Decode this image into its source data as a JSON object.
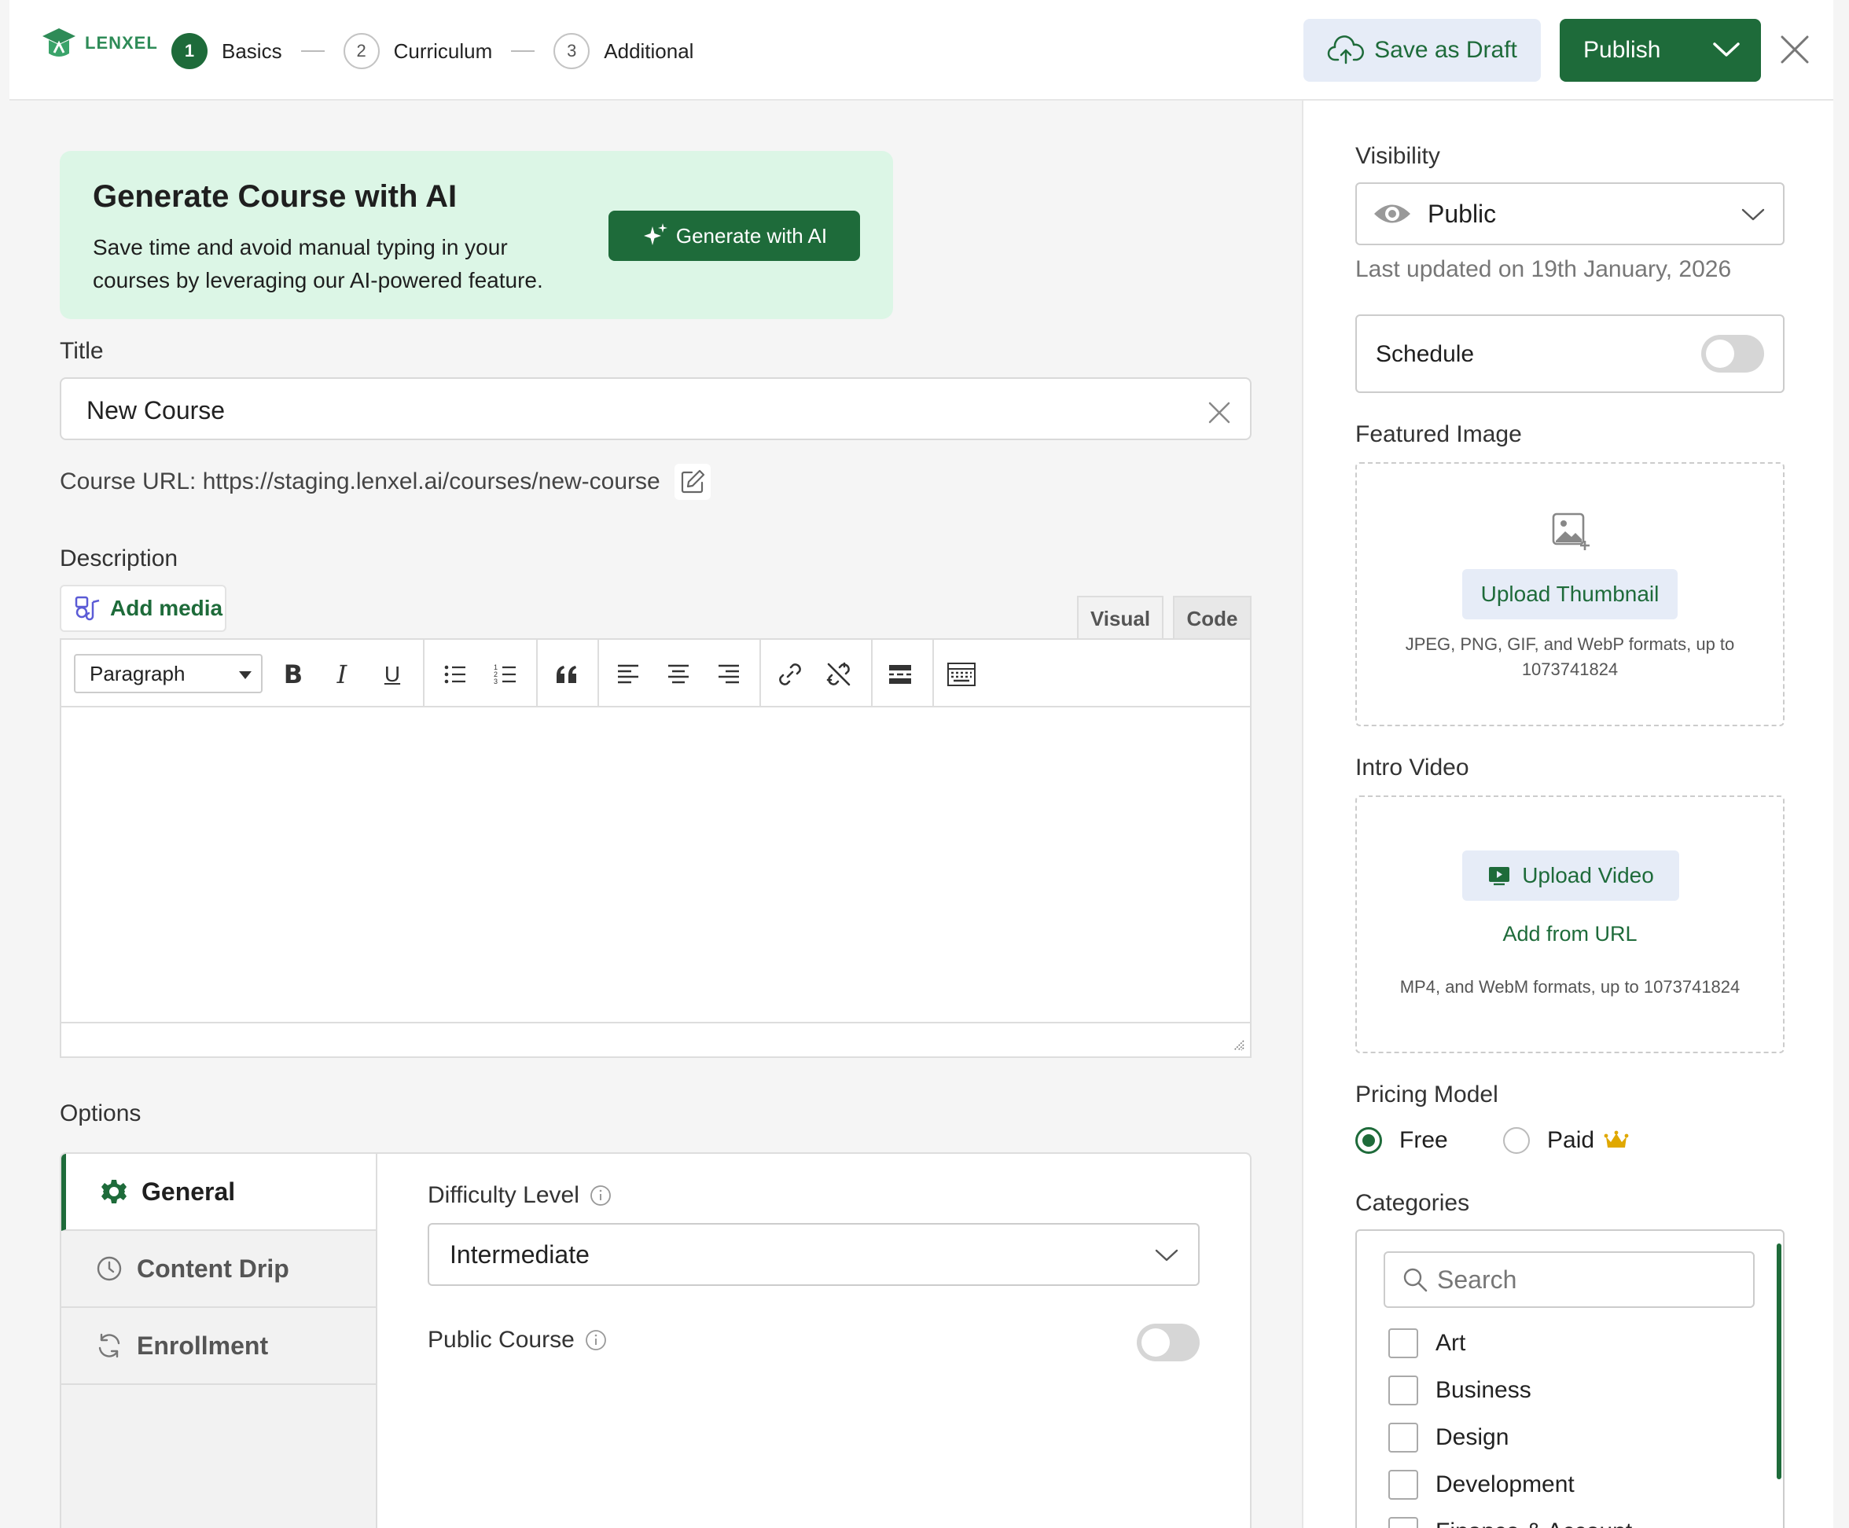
{
  "brand": {
    "name": "LENXEL",
    "accent": "#1e6b3a"
  },
  "steps": [
    {
      "num": "1",
      "label": "Basics"
    },
    {
      "num": "2",
      "label": "Curriculum"
    },
    {
      "num": "3",
      "label": "Additional"
    }
  ],
  "header": {
    "save_draft": "Save as Draft",
    "publish": "Publish"
  },
  "ai_card": {
    "title": "Generate Course with AI",
    "desc": "Save time and avoid manual typing in your courses by leveraging our AI-powered feature.",
    "button": "Generate with AI"
  },
  "title_field": {
    "label": "Title",
    "value": "New Course"
  },
  "course_url": {
    "text": "Course URL: https://staging.lenxel.ai/courses/new-course"
  },
  "description": {
    "label": "Description",
    "add_media": "Add media",
    "tab_visual": "Visual",
    "tab_code": "Code",
    "format": "Paragraph",
    "bold": "B",
    "italic": "I",
    "underline": "U"
  },
  "options": {
    "label": "Options",
    "tabs": [
      "General",
      "Content Drip",
      "Enrollment"
    ],
    "difficulty_label": "Difficulty Level",
    "difficulty_value": "Intermediate",
    "public_label": "Public Course",
    "public_on": false
  },
  "sidebar": {
    "visibility_label": "Visibility",
    "visibility_value": "Public",
    "last_updated": "Last updated on 19th January, 2026",
    "schedule_label": "Schedule",
    "schedule_on": false,
    "featured_label": "Featured Image",
    "upload_thumbnail": "Upload Thumbnail",
    "thumb_note": "JPEG, PNG, GIF, and WebP formats, up to 1073741824",
    "intro_label": "Intro Video",
    "upload_video": "Upload Video",
    "add_url": "Add from URL",
    "video_note": "MP4, and WebM formats, up to 1073741824",
    "pricing_label": "Pricing Model",
    "pricing_free": "Free",
    "pricing_paid": "Paid",
    "pricing_selected": "Free",
    "categories_label": "Categories",
    "search_placeholder": "Search",
    "categories": [
      "Art",
      "Business",
      "Design",
      "Development",
      "Finance & Account"
    ]
  }
}
